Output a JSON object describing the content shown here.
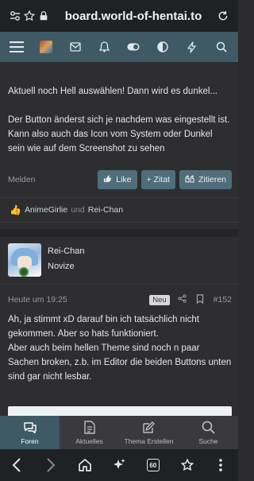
{
  "browser": {
    "url": "board.world-of-hentai.to",
    "tab_count": "60"
  },
  "forum_header": {
    "icons": [
      "menu-icon",
      "avatar",
      "mail-icon",
      "bell-icon",
      "toggle-icon",
      "contrast-icon",
      "bolt-icon",
      "search-icon"
    ]
  },
  "post1": {
    "paragraph1": "Aktuell noch Hell auswählen! Dann wird es dunkel...",
    "paragraph2": "Der Button änderst sich je nachdem was eingestellt ist. Kann also auch das Icon vom System oder Dunkel sein wie auf dem Screenshot zu sehen",
    "report_label": "Melden",
    "like_label": "Like",
    "zitat_label": "+ Zitat",
    "zitieren_label": "Zitieren",
    "reaction_user1": "AnimeGirlie",
    "reaction_and": "und",
    "reaction_user2": "Rei-Chan"
  },
  "post2": {
    "username": "Rei-Chan",
    "user_title": "Novize",
    "time": "Heute um 19:25",
    "badge": "Neu",
    "post_number": "#152",
    "line1": "Ah, ja stimmt xD darauf bin ich tatsächlich nicht gekommen. Aber so hats funktioniert.",
    "line2": "Aber auch beim hellen Theme sind noch n paar Sachen broken, z.b. im Editor die beiden Buttons unten sind gar nicht lesbar."
  },
  "bottom_nav": {
    "items": [
      {
        "label": "Foren",
        "icon": "chat-icon"
      },
      {
        "label": "Aktuelles",
        "icon": "document-icon"
      },
      {
        "label": "Thema Erstellen",
        "icon": "edit-icon"
      },
      {
        "label": "Suche",
        "icon": "search-icon"
      }
    ]
  },
  "colors": {
    "header_bg": "#3f5a64",
    "button_bg": "#4f6e7a",
    "page_bg": "#2e2e30",
    "reaction_thumb": "#f3c24a"
  }
}
